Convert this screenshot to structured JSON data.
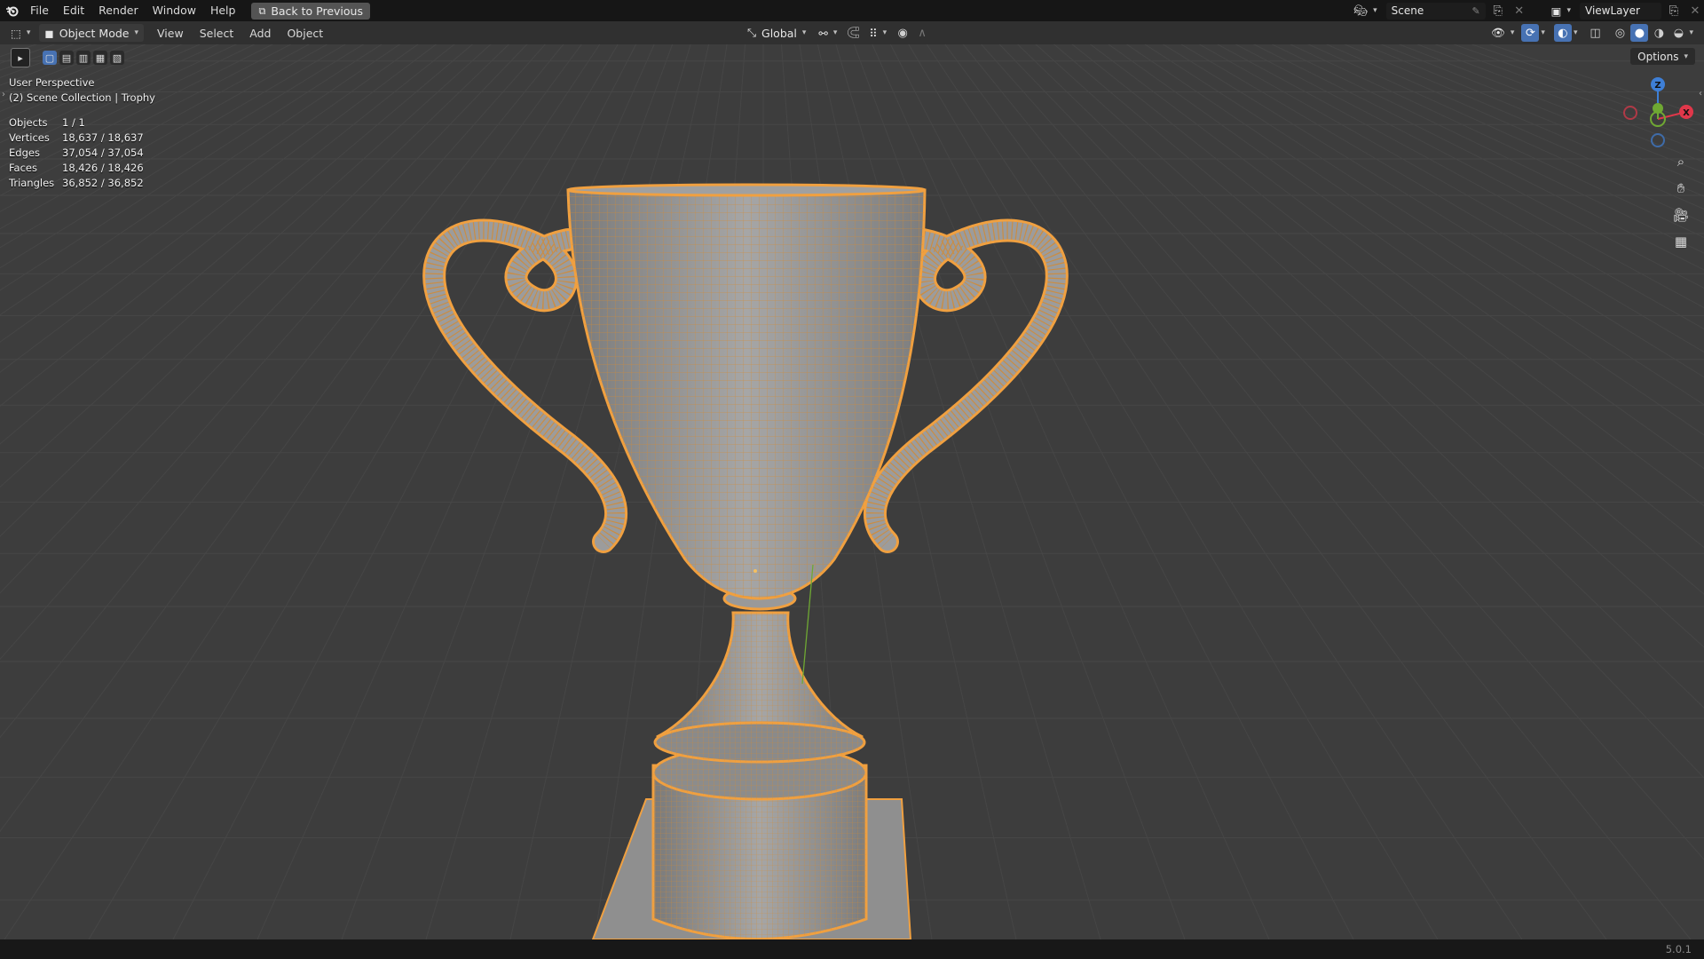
{
  "menu": {
    "items": [
      "File",
      "Edit",
      "Render",
      "Window",
      "Help"
    ],
    "back_button": "Back to Previous"
  },
  "workspace": {
    "scene": "Scene",
    "view_layer": "ViewLayer"
  },
  "header": {
    "mode": "Object Mode",
    "menus": [
      "View",
      "Select",
      "Add",
      "Object"
    ],
    "transform_orientation": "Global",
    "options": "Options"
  },
  "viewport": {
    "view_name": "User Perspective",
    "collection": "(2) Scene Collection | Trophy",
    "stats": [
      {
        "label": "Objects",
        "value": "1 / 1"
      },
      {
        "label": "Vertices",
        "value": "18,637 / 18,637"
      },
      {
        "label": "Edges",
        "value": "37,054 / 37,054"
      },
      {
        "label": "Faces",
        "value": "18,426 / 18,426"
      },
      {
        "label": "Triangles",
        "value": "36,852 / 36,852"
      }
    ],
    "gizmo": {
      "z": "Z",
      "x": "X"
    },
    "colors": {
      "selection": "#f0a040",
      "background": "#3d3d3d",
      "x_axis": "#e0374a",
      "y_axis": "#6fa833",
      "z_axis": "#3e7fd6"
    }
  },
  "status": {
    "version": "5.0.1"
  },
  "icons": [
    "blender-logo-icon",
    "back-icon",
    "editor-type-icon",
    "object-mode-icon",
    "transform-orientation-icon",
    "pivot-icon",
    "snap-icon",
    "proportional-icon",
    "select-tool-icon",
    "visibility-icon",
    "gizmo-icon",
    "overlay-icon",
    "xray-icon",
    "shading-wireframe-icon",
    "shading-solid-icon",
    "shading-material-icon",
    "shading-rendered-icon",
    "zoom-icon",
    "pan-hand-icon",
    "camera-icon",
    "ortho-grid-icon"
  ]
}
